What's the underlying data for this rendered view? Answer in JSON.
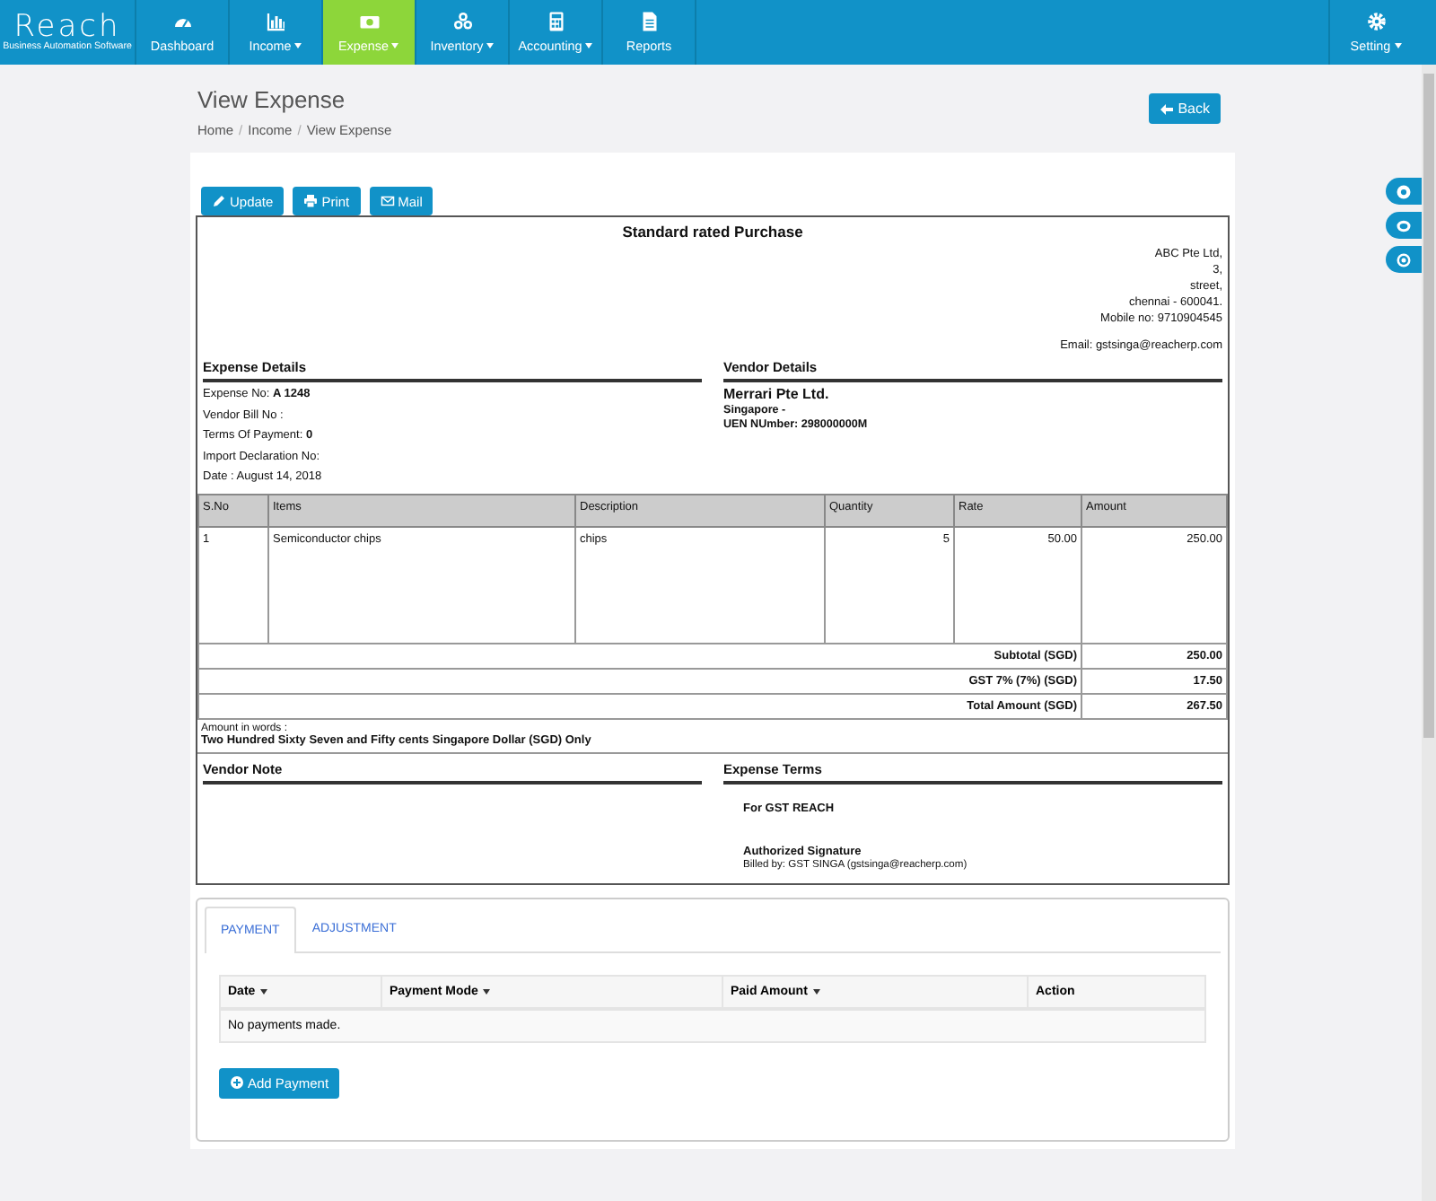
{
  "app": {
    "logo": "Reach",
    "tagline": "Business Automation Software"
  },
  "nav": [
    {
      "label": "Dashboard",
      "dropdown": false,
      "selected": false
    },
    {
      "label": "Income",
      "dropdown": true,
      "selected": false
    },
    {
      "label": "Expense",
      "dropdown": true,
      "selected": true
    },
    {
      "label": "Inventory",
      "dropdown": true,
      "selected": false
    },
    {
      "label": "Accounting",
      "dropdown": true,
      "selected": false
    },
    {
      "label": "Reports",
      "dropdown": false,
      "selected": false
    }
  ],
  "nav_right": {
    "label": "Setting",
    "dropdown": true
  },
  "page": {
    "title": "View Expense",
    "breadcrumb": [
      {
        "label": "Home",
        "separator": "/"
      },
      {
        "label": "Income",
        "separator": "/"
      },
      {
        "label": "View Expense"
      }
    ],
    "back_button": "Back"
  },
  "actions": [
    {
      "label": "Update"
    },
    {
      "label": "Print"
    },
    {
      "label": "Mail"
    }
  ],
  "invoice": {
    "title": "Standard rated Purchase",
    "company_lines": [
      "ABC Pte Ltd,",
      "3,",
      "street,",
      "chennai - 600041.",
      "Mobile no: 9710904545"
    ],
    "company_email": "Email: gstsinga@reacherp.com",
    "expense_details": {
      "heading": "Expense Details",
      "fields": [
        {
          "label": "Expense No:",
          "value": "A 1248"
        },
        {
          "label": "Vendor Bill No :"
        },
        {
          "label": "Terms Of Payment:",
          "value": "0"
        },
        {
          "label": "Import Declaration No:"
        },
        {
          "label": "Date : August 14, 2018"
        }
      ]
    },
    "vendor_details": {
      "heading": "Vendor Details",
      "name": "Merrari Pte Ltd.",
      "lines": [
        "Singapore -",
        "UEN NUmber: 298000000M"
      ]
    },
    "table": {
      "columns": [
        "S.No",
        "Items",
        "Description",
        "Quantity",
        "Rate",
        "Amount"
      ],
      "rows": [
        [
          "1",
          "Semiconductor chips",
          "chips",
          "5",
          "50.00",
          "250.00"
        ]
      ]
    },
    "totals": [
      {
        "label": "Subtotal (SGD)",
        "value": "250.00"
      },
      {
        "label": "GST 7% (7%) (SGD)",
        "value": "17.50"
      },
      {
        "label": "Total Amount (SGD)",
        "value": "267.50"
      }
    ],
    "amount_in_words": {
      "label": "Amount in words :",
      "text": "Two Hundred Sixty Seven and Fifty cents Singapore Dollar (SGD) Only"
    },
    "vendor_note": {
      "heading": "Vendor Note"
    },
    "expense_terms": {
      "heading": "Expense Terms",
      "for_line": "For GST REACH",
      "signature": "Authorized Signature",
      "billed_by": "Billed by: GST SINGA (gstsinga@reacherp.com)"
    }
  },
  "payments": {
    "tabs": [
      {
        "label": "PAYMENT",
        "selected": true
      },
      {
        "label": "ADJUSTMENT",
        "selected": false
      }
    ],
    "columns": [
      {
        "label": "Date",
        "sortable": true
      },
      {
        "label": "Payment Mode",
        "sortable": true
      },
      {
        "label": "Paid Amount",
        "sortable": true
      },
      {
        "label": "Action",
        "sortable": false
      }
    ],
    "empty_text": "No payments made.",
    "add_button": "Add Payment"
  }
}
